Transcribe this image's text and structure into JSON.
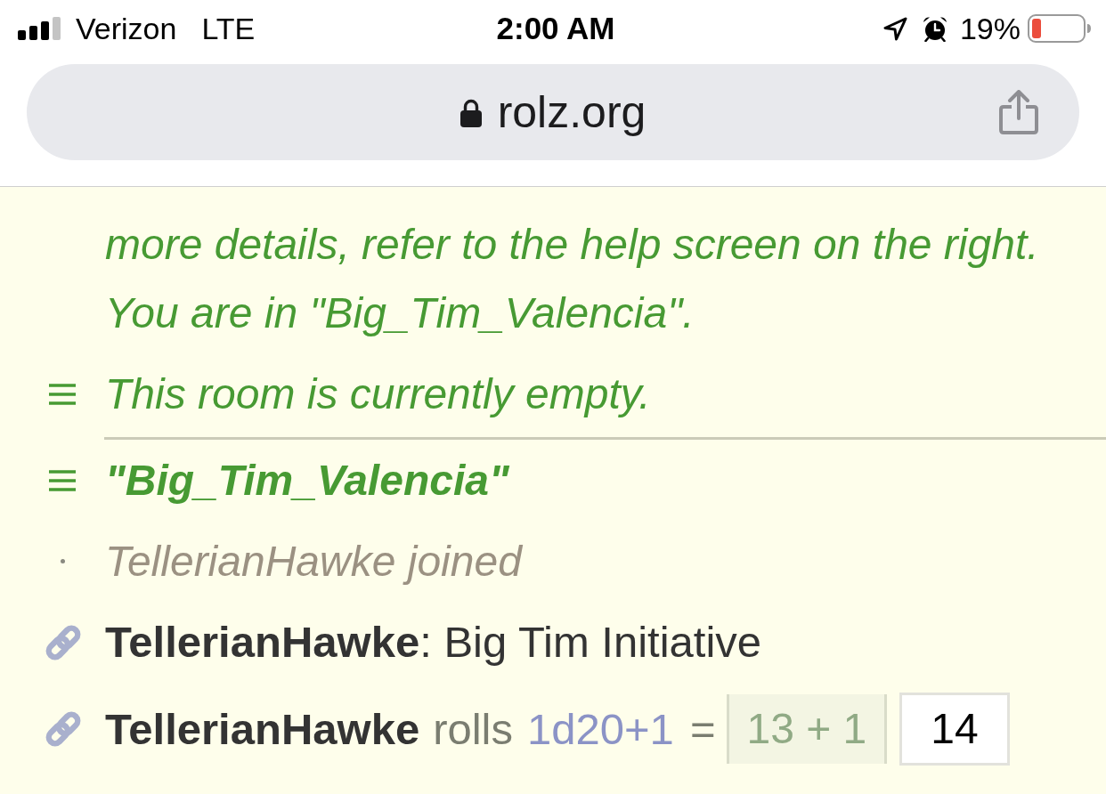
{
  "status_bar": {
    "carrier": "Verizon",
    "network": "LTE",
    "time": "2:00 AM",
    "battery": "19%"
  },
  "address_bar": {
    "url": "rolz.org"
  },
  "messages": [
    {
      "kind": "text",
      "divider_above": false,
      "lines": [
        "more details, refer to the help screen on the right.",
        "You are in \"Big_Tim_Valencia\"."
      ]
    },
    {
      "kind": "notice",
      "divider_above": false,
      "lines": [
        "This room is currently empty."
      ]
    },
    {
      "kind": "room",
      "divider_above": true,
      "lines": [
        "\"Big_Tim_Valencia\""
      ]
    },
    {
      "kind": "event",
      "divider_above": false,
      "lines": [
        "TellerianHawke joined"
      ]
    },
    {
      "kind": "chat",
      "divider_above": false,
      "user": "TellerianHawke",
      "text": ": Big Tim Initiative"
    },
    {
      "kind": "roll",
      "divider_above": false,
      "user": "TellerianHawke",
      "verb": "rolls",
      "dice": "1d20+1",
      "equals": "=",
      "breakdown": "13 + 1",
      "total": "14"
    }
  ]
}
